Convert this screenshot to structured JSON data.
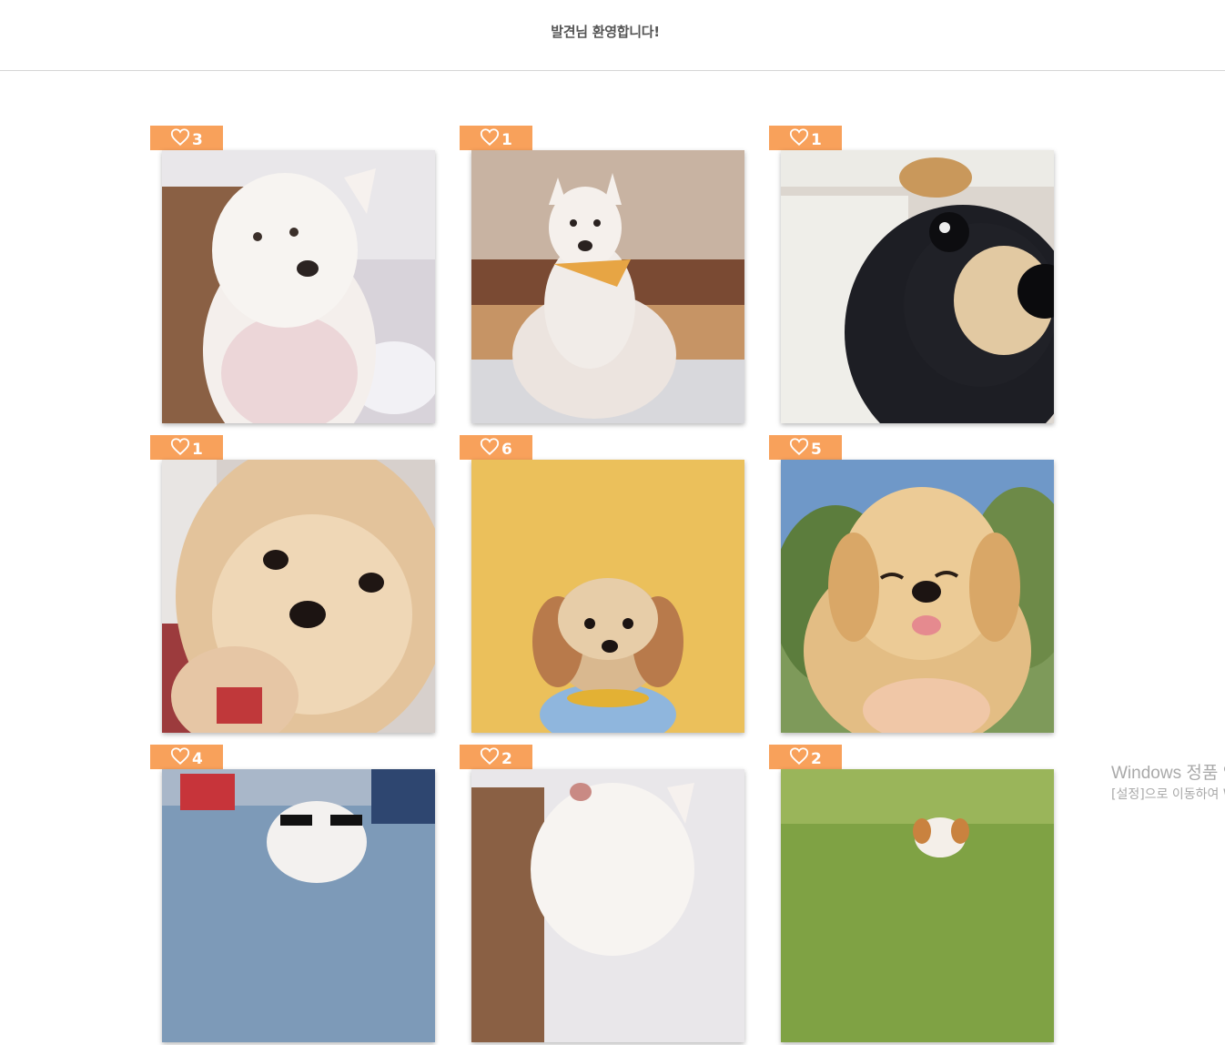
{
  "header": {
    "welcome_text": "발견님 환영합니다!"
  },
  "icons": {
    "like": "heart-outline-icon"
  },
  "colors": {
    "like_badge": "#f8a15b",
    "header_text": "#555555",
    "divider": "#d6d6d6"
  },
  "gallery": {
    "items": [
      {
        "likes": "3",
        "photo": "white pomeranian sitting on sofa"
      },
      {
        "likes": "1",
        "photo": "white shiba-like dog with bandana sitting on floor"
      },
      {
        "likes": "1",
        "photo": "black and tan puppy close-up"
      },
      {
        "likes": "1",
        "photo": "fluffy cream pomeranian close-up"
      },
      {
        "likes": "6",
        "photo": "shih tzu mix in blue shirt on yellow background"
      },
      {
        "likes": "5",
        "photo": "golden retriever puppy smiling"
      },
      {
        "likes": "4",
        "photo": "white dogs wearing sunglasses outdoors"
      },
      {
        "likes": "2",
        "photo": "white pomeranian"
      },
      {
        "likes": "2",
        "photo": "puppy running on grass"
      }
    ]
  },
  "watermark": {
    "title": "Windows 정품 인증",
    "subtitle": "[설정]으로 이동하여 Windows를 정품 인증합니다."
  }
}
